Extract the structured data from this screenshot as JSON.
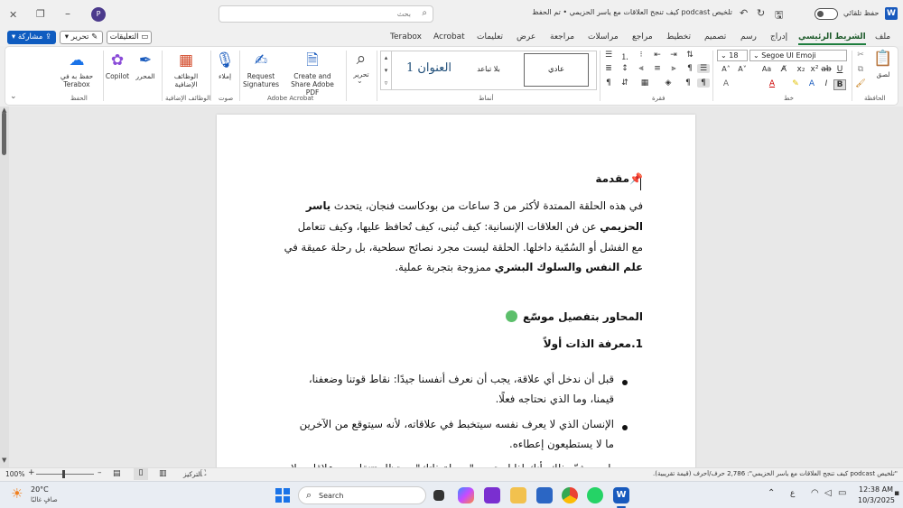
{
  "titlebar": {
    "autosave_label": "حفظ تلقائي",
    "title": "تلخيص podcast كيف تنجح العلاقات مع ياسر الحزيمي • تم الحفظ",
    "search_placeholder": "بحث",
    "avatar_initial": "P"
  },
  "tabs": [
    "ملف",
    "الشريط الرئيسي",
    "إدراج",
    "رسم",
    "تصميم",
    "تخطيط",
    "مراجع",
    "مراسلات",
    "مراجعة",
    "عرض",
    "تعليمات",
    "Acrobat",
    "Terabox"
  ],
  "actions": {
    "comments": "التعليقات",
    "edit": "تحرير",
    "share": "مشاركة"
  },
  "ribbon": {
    "clipboard": {
      "label": "الحافظة",
      "paste": "لصق"
    },
    "font": {
      "label": "خط",
      "name": "Segoe UI Emoji",
      "size": "18"
    },
    "paragraph": {
      "label": "فقرة"
    },
    "styles": {
      "label": "أنماط",
      "normal": "عادي",
      "no_spacing": "بلا تباعد",
      "heading1": "العنوان 1"
    },
    "editing": {
      "label": "تحرير"
    },
    "acrobat": {
      "label": "Adobe Acrobat",
      "create_share": "Create and Share Adobe PDF",
      "request_signatures": "Request Signatures"
    },
    "voice": {
      "label": "صوت",
      "dictate": "إملاء"
    },
    "addins": {
      "label": "الوظائف الإضافية",
      "btn": "الوظائف الإضافية"
    },
    "copilot": {
      "editor": "المحرر",
      "copilot": "Copilot"
    },
    "save": {
      "label": "الحفظ",
      "btn": "حفظ به في Terabox"
    }
  },
  "document": {
    "intro_heading_icon": "📌",
    "intro_heading": "مقدمة",
    "intro_l1": "في هذه الحلقة الممتدة لأكثر من 3 ساعات من بودكاست فنجان، يتحدث ",
    "intro_l1_b": "ياسر",
    "intro_l2_b": "الحزيمي",
    "intro_l2": " عن فن العلاقات الإنسانية: كيف تُبنى، كيف تُحافظ عليها، وكيف تتعامل",
    "intro_l3": "مع الفشل أو السُمّية داخلها. الحلقة ليست مجرد نصائح سطحية، بل رحلة عميقة في",
    "intro_l4_b": "علم النفس والسلوك البشري",
    "intro_l4": " ممزوجة بتجربة عملية.",
    "axes_heading": "المحاور بتفصيل موسّع",
    "section1": "1.معرفة الذات أولاً",
    "b1_l1": "قبل أن ندخل أي علاقة، يجب أن نعرف أنفسنا جيدًا: نقاط قوتنا وضعفنا،",
    "b1_l2": "قيمنا، وما الذي نحتاجه فعلًا.",
    "b2_l1": "الإنسان الذي لا يعرف نفسه سيتخبط في علاقاته، لأنه سيتوقع من الآخرين",
    "b2_l2": "ما لا يستطيعون إعطاءه.",
    "b3_l1": "ياسر يشبّه ذلك بأنك إذا لم تحدد \"بوصلة ذاتك\"، ستظل تتنقل بين علاقات بلا"
  },
  "status": {
    "zoom": "100%",
    "focus": "التركيز",
    "words": "\"تلخيص podcast كيف تنجح العلاقات مع ياسر الحزيمي\": 2,786 حرف/أحرف (قيمة تقريبية)."
  },
  "taskbar": {
    "weather_temp": "20°C",
    "weather_desc": "صافٍ غالبًا",
    "search": "Search",
    "time": "12:38 AM",
    "date": "10/3/2025",
    "lang": "ع"
  },
  "colors": {
    "accent": "#1e7e3e",
    "share": "#0f5cc0",
    "word": "#185abd"
  }
}
